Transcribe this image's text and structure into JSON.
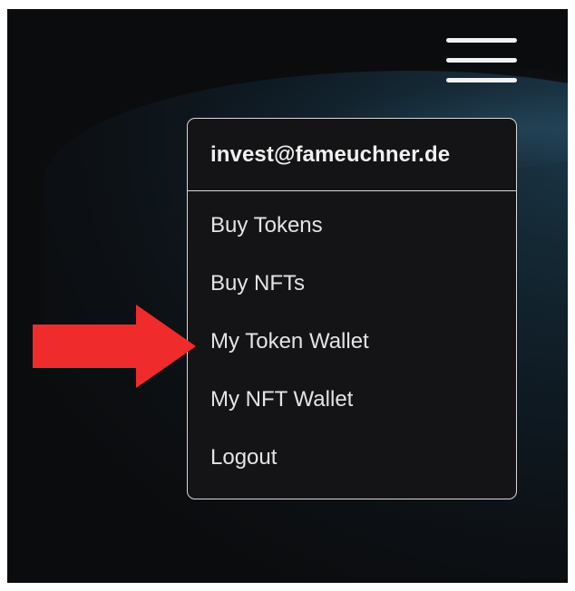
{
  "menu": {
    "email": "invest@fameuchner.de",
    "items": [
      {
        "label": "Buy Tokens"
      },
      {
        "label": "Buy NFTs"
      },
      {
        "label": "My Token Wallet"
      },
      {
        "label": "My NFT Wallet"
      },
      {
        "label": "Logout"
      }
    ]
  },
  "icons": {
    "hamburger": "hamburger-menu-icon",
    "arrow": "annotation-arrow-icon"
  },
  "colors": {
    "background": "#0b0c0e",
    "menu_background": "#141416",
    "menu_border": "#d9d9d9",
    "text": "#e4e4e4",
    "arrow": "#f02b2b"
  }
}
